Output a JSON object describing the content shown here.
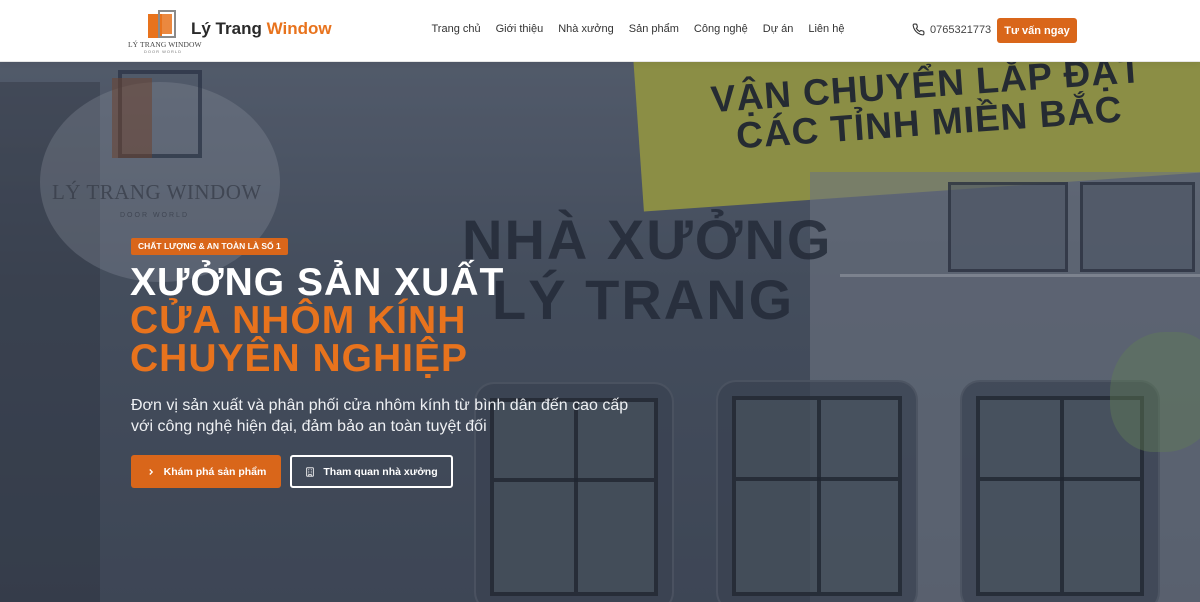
{
  "header": {
    "logo_text": "LÝ TRANG WINDOW",
    "logo_subtext": "DOOR WORLD",
    "brand_part1": "Lý Trang",
    "brand_part2": "Window",
    "nav": [
      {
        "label": "Trang chủ"
      },
      {
        "label": "Giới thiệu"
      },
      {
        "label": "Nhà xưởng"
      },
      {
        "label": "Sản phẩm"
      },
      {
        "label": "Công nghệ"
      },
      {
        "label": "Dự án"
      },
      {
        "label": "Liên hệ"
      }
    ],
    "phone": "0765321773",
    "cta_label": "Tư vấn ngay"
  },
  "hero": {
    "background": {
      "brand": "LÝ TRANG WINDOW",
      "brand_sub": "DOOR WORLD",
      "banner_line1": "VẬN CHUYỂN LẮP ĐẶT",
      "banner_line2": "CÁC TỈNH MIỀN BẮC",
      "factory_line1": "NHÀ XƯỞNG",
      "factory_line2": "LÝ TRANG"
    },
    "badge": "CHẤT LƯỢNG & AN TOÀN LÀ SỐ 1",
    "headline_line1": "XƯỞNG SẢN XUẤT",
    "headline_line2": "CỬA NHÔM KÍNH",
    "headline_line3": "CHUYÊN NGHIỆP",
    "description": "Đơn vị sản xuất và phân phối cửa nhôm kính từ bình dân đến cao cấp với công nghệ hiện đại, đảm bảo an toàn tuyệt đối",
    "primary_button": "Khám phá sản phẩm",
    "secondary_button": "Tham quan nhà xưởng"
  },
  "colors": {
    "accent": "#d9661a",
    "brand_orange": "#e8731d",
    "dark_text": "#2a2a2a"
  },
  "icons": {
    "phone": "phone-icon",
    "primary_button": "chevron-right-icon",
    "secondary_button": "building-icon"
  }
}
